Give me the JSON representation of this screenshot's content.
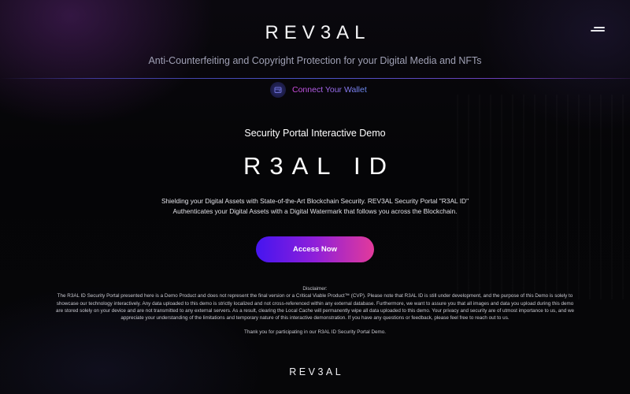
{
  "header": {
    "logo_text": "REV3AL",
    "menu_icon": "hamburger-menu-icon",
    "tagline": "Anti-Counterfeiting and Copyright Protection for your Digital Media and NFTs"
  },
  "wallet": {
    "icon": "wallet-icon",
    "label": "Connect Your Wallet"
  },
  "hero": {
    "subtitle": "Security Portal Interactive Demo",
    "title": "R3AL ID",
    "description": "Shielding your Digital Assets with State-of-the-Art Blockchain Security. REV3AL Security Portal \"R3AL ID\" Authenticates your Digital Assets with a Digital Watermark that follows you across the Blockchain.",
    "cta_label": "Access Now"
  },
  "disclaimer": {
    "heading": "Disclaimer:",
    "body": "The R3AL ID Security Portal presented here is a Demo Product and does not represent the final version or a Critical Viable Product™ (CVP). Please note that R3AL ID is still under development, and the purpose of this Demo is solely to showcase our technology interactively. Any data uploaded to this demo is strictly localized and not cross-referenced within any external database. Furthermore, we want to assure you that all images and data you upload during this demo are stored solely on your device and are not transmitted to any external servers. As a result, clearing the Local Cache will permanently wipe all data uploaded to this demo. Your privacy and security are of utmost importance to us, and we appreciate your understanding of the limitations and temporary nature of this interactive demonstration. If you have any questions or feedback, please feel free to reach out to us.",
    "thanks": "Thank you for participating in our R3AL ID Security Portal Demo."
  },
  "footer": {
    "logo_text": "REV3AL"
  },
  "colors": {
    "background": "#050507",
    "button_gradient_start": "#4515f0",
    "button_gradient_end": "#e23a9b",
    "wallet_text_start": "#d44be0",
    "wallet_text_end": "#6a8ef5",
    "tagline": "#9fa0b4",
    "rule": "#4b55c9"
  }
}
